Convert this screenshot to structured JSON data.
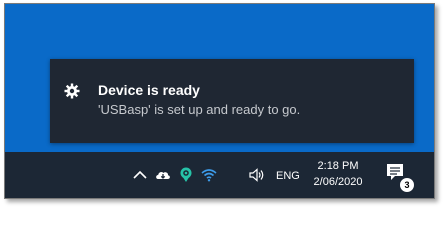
{
  "notification": {
    "title": "Device is ready",
    "message": "'USBasp' is set up and ready to go.",
    "icon": "gear-icon"
  },
  "taskbar": {
    "tray_icons": [
      "chevron-up-icon",
      "onedrive-cloud-icon",
      "location-pin-icon",
      "wifi-icon",
      "volume-icon"
    ],
    "language": "ENG",
    "time": "2:18 PM",
    "date": "2/06/2020",
    "notification_count": "3"
  },
  "colors": {
    "desktop": "#0a6ac8",
    "toast": "#1f2733",
    "taskbar": "#1c2735",
    "accent": "#26c2a8"
  }
}
